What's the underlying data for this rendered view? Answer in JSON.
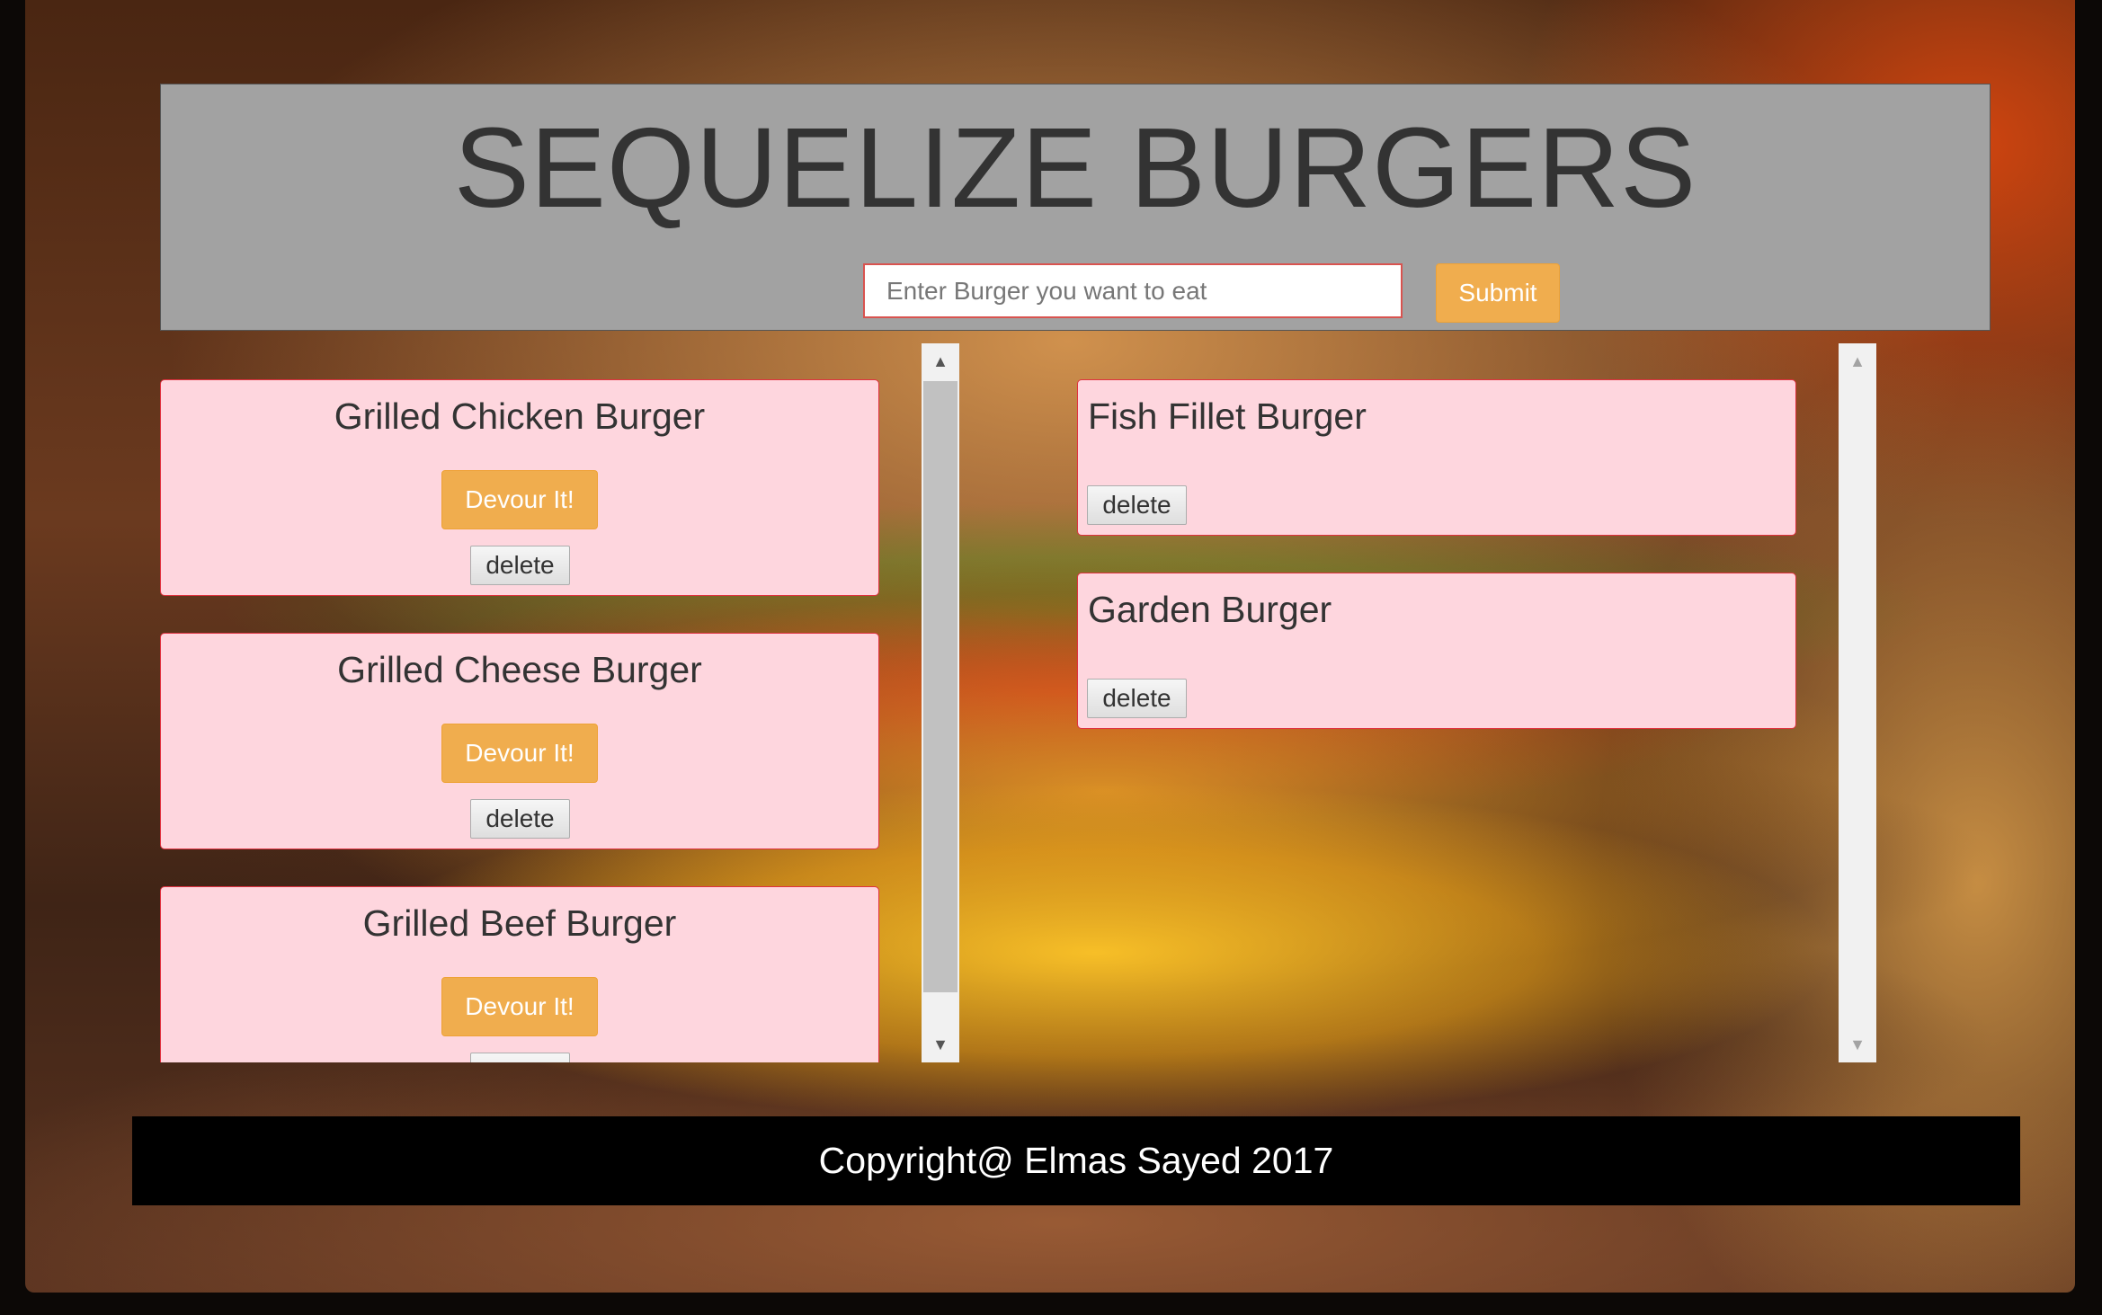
{
  "header": {
    "title": "SEQUELIZE BURGERS",
    "input_placeholder": "Enter Burger you want to eat",
    "input_value": "",
    "submit_label": "Submit"
  },
  "uneaten_burgers": [
    {
      "name": "Grilled Chicken Burger",
      "devour_label": "Devour It!",
      "delete_label": "delete"
    },
    {
      "name": "Grilled Cheese Burger",
      "devour_label": "Devour It!",
      "delete_label": "delete"
    },
    {
      "name": "Grilled Beef Burger",
      "devour_label": "Devour It!",
      "delete_label": "delete"
    }
  ],
  "devoured_burgers": [
    {
      "name": "Fish Fillet Burger",
      "delete_label": "delete"
    },
    {
      "name": "Garden Burger",
      "delete_label": "delete"
    }
  ],
  "footer": {
    "copyright": "Copyright@ Elmas Sayed 2017"
  },
  "colors": {
    "header_bg": "#a2a2a2",
    "card_bg": "#fed6de",
    "card_border": "#e0313f",
    "accent_button": "#f0ad4e",
    "footer_bg": "#000000"
  },
  "icons": {
    "scroll_up": "scroll-up-arrow-icon",
    "scroll_down": "scroll-down-arrow-icon"
  }
}
